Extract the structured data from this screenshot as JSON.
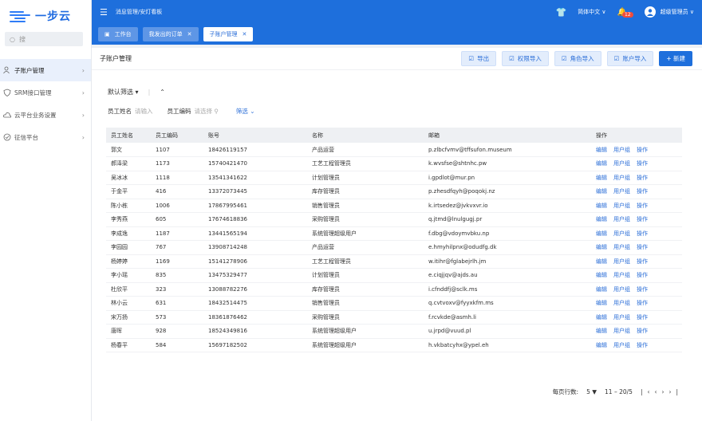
{
  "app": {
    "logo_text": "一步云"
  },
  "sidebar": {
    "search_placeholder": "搜",
    "items": [
      {
        "label": "子账户管理",
        "icon": "user-group-icon",
        "active": true
      },
      {
        "label": "SRM接口管理",
        "icon": "shield-icon",
        "active": false
      },
      {
        "label": "云平台业务设置",
        "icon": "cloud-icon",
        "active": false
      },
      {
        "label": "征信平台",
        "icon": "badge-icon",
        "active": false
      }
    ]
  },
  "topbar": {
    "breadcrumb": "消息管理/安灯看板",
    "language": "简体中文 ∨",
    "notification_count": "12",
    "user_name": "超级管理员 ∨"
  },
  "tabs": [
    {
      "label": "工作台",
      "closable": false,
      "active": false
    },
    {
      "label": "我发出的订单",
      "closable": true,
      "active": false
    },
    {
      "label": "子账户管理",
      "closable": true,
      "active": true
    }
  ],
  "page": {
    "title": "子账户管理",
    "buttons": {
      "export": "导出",
      "perm_import": "权限导入",
      "role_import": "角色导入",
      "account_import": "账户导入",
      "new": "+ 新建"
    }
  },
  "filters": {
    "default_filter": "默认筛选",
    "name_label": "员工姓名",
    "name_placeholder": "请输入",
    "code_label": "员工编码",
    "code_placeholder": "请选择",
    "filter_link": "筛选"
  },
  "table": {
    "headers": [
      "员工姓名",
      "员工编码",
      "账号",
      "名称",
      "邮箱",
      "操作"
    ],
    "op_labels": [
      "编辑",
      "用户组",
      "操作"
    ],
    "rows": [
      [
        "郭文",
        "1107",
        "18426119157",
        "产品运营",
        "p.zlbcfvmv@tffsufon.museum"
      ],
      [
        "郝泽梁",
        "1173",
        "15740421470",
        "工艺工程管理员",
        "k.wvsfse@shtnhc.pw"
      ],
      [
        "吴冰冰",
        "1118",
        "13541341622",
        "计划管理员",
        "i.gpdlot@mur.pn"
      ],
      [
        "于金平",
        "416",
        "13372073445",
        "库存管理员",
        "p.zhesdfqyh@poqokj.nz"
      ],
      [
        "陈小栋",
        "1006",
        "17867995461",
        "销售管理员",
        "k.irtsedez@jvkvxvr.io"
      ],
      [
        "李秀燕",
        "605",
        "17674618836",
        "采购管理员",
        "q.jtmd@lnulgugj.pr"
      ],
      [
        "李成逸",
        "1187",
        "13441565194",
        "系统管理超级用户",
        "f.dbg@vdoymvbku.np"
      ],
      [
        "李园园",
        "767",
        "13908714248",
        "产品运营",
        "e.hmyhilpnx@odudfg.dk"
      ],
      [
        "杨婷婷",
        "1169",
        "15141278906",
        "工艺工程管理员",
        "w.itihr@fglabejrlh.jm"
      ],
      [
        "李小瑶",
        "835",
        "13475329477",
        "计划管理员",
        "e.ciqjjqv@ajds.au"
      ],
      [
        "杜欣平",
        "323",
        "13088782276",
        "库存管理员",
        "i.cfnddfj@sclk.ms"
      ],
      [
        "林小云",
        "631",
        "18432514475",
        "销售管理员",
        "q.cvtvoxv@fyyxkfm.ms"
      ],
      [
        "宋万扬",
        "573",
        "18361876462",
        "采购管理员",
        "f.rcvkde@asmh.li"
      ],
      [
        "唐晖",
        "928",
        "18524349816",
        "系统管理超级用户",
        "u.jrpd@vuud.pl"
      ],
      [
        "杨春平",
        "584",
        "15697182502",
        "系统管理超级用户",
        "h.vkbatcyhx@ypel.eh"
      ]
    ]
  },
  "pagination": {
    "rows_label": "每页行数:",
    "page_size": "5",
    "range": "11 – 20/5"
  },
  "colors": {
    "primary": "#1e6fdc",
    "link": "#2c6fd8"
  }
}
